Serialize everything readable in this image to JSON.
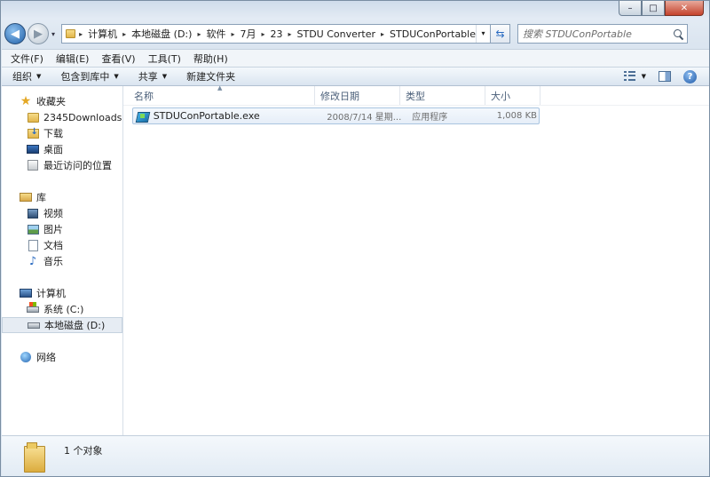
{
  "window": {
    "caption_min": "–",
    "caption_max": "□",
    "caption_close": "✕"
  },
  "address": {
    "crumbs": [
      "计算机",
      "本地磁盘 (D:)",
      "软件",
      "7月",
      "23",
      "STDU Converter",
      "STDUConPortable"
    ],
    "separator": "▸",
    "dropdown": "▾"
  },
  "search": {
    "placeholder": "搜索 STDUConPortable"
  },
  "menubar": {
    "items": [
      "文件(F)",
      "编辑(E)",
      "查看(V)",
      "工具(T)",
      "帮助(H)"
    ]
  },
  "cmdbar": {
    "organize": "组织",
    "include_in_library": "包含到库中",
    "share": "共享",
    "new_folder": "新建文件夹",
    "caret": "▼"
  },
  "nav": {
    "favorites": {
      "label": "收藏夹",
      "items": [
        "2345Downloads",
        "下载",
        "桌面",
        "最近访问的位置"
      ]
    },
    "library": {
      "label": "库",
      "items": [
        "视频",
        "图片",
        "文档",
        "音乐"
      ]
    },
    "computer": {
      "label": "计算机",
      "items": [
        "系统 (C:)",
        "本地磁盘 (D:)"
      ]
    },
    "network": {
      "label": "网络"
    }
  },
  "columns": {
    "name": "名称",
    "date": "修改日期",
    "type": "类型",
    "size": "大小"
  },
  "files": [
    {
      "name": "STDUConPortable.exe",
      "date": "2008/7/14 星期...",
      "type": "应用程序",
      "size": "1,008 KB"
    }
  ],
  "status": {
    "count": "1 个对象"
  },
  "colors": {
    "accent": "#1f5fa8",
    "selection": "#e6eef8"
  }
}
